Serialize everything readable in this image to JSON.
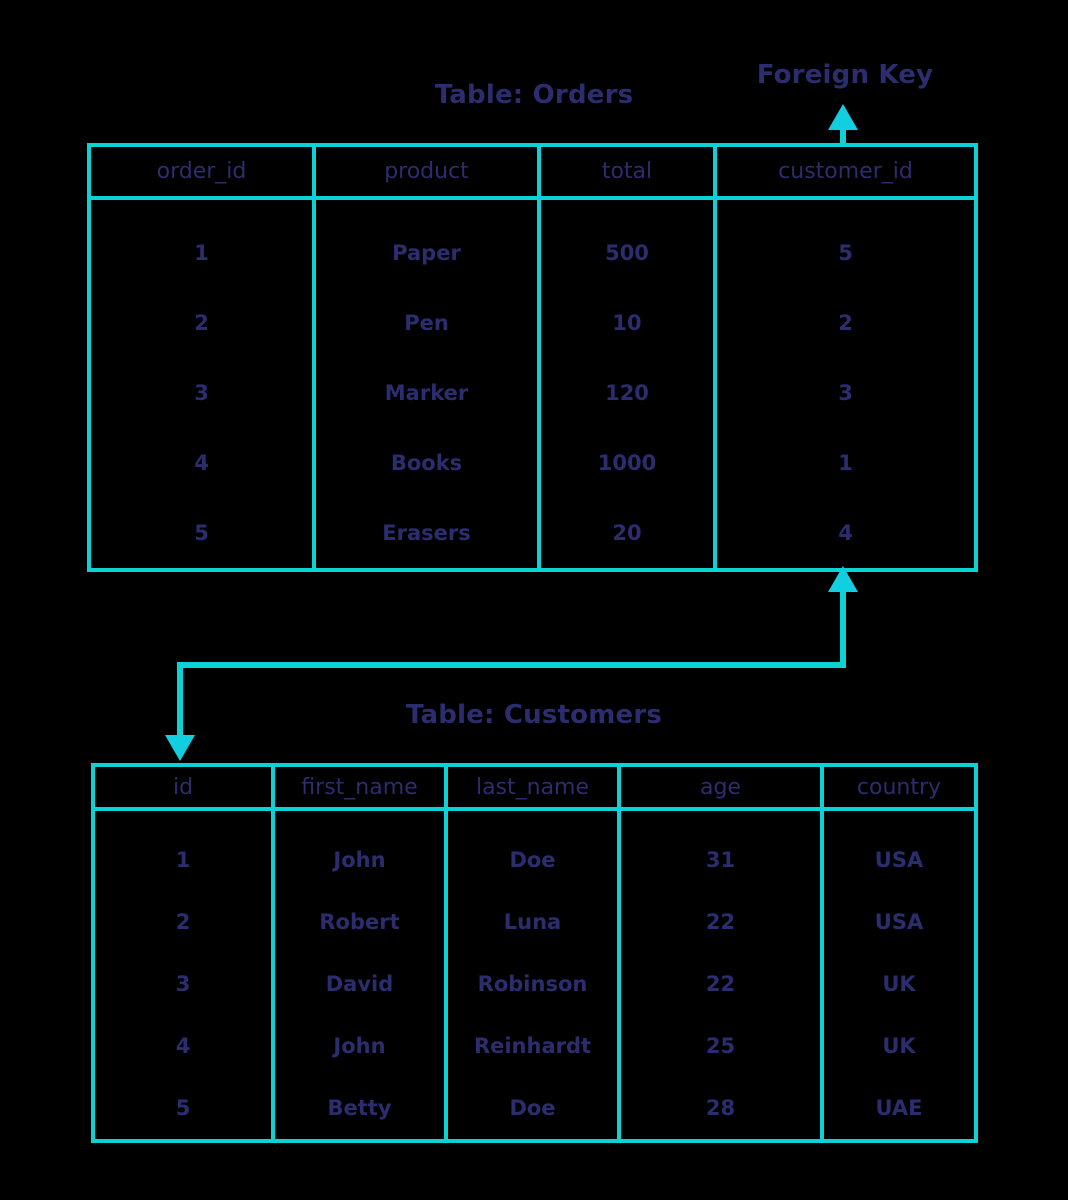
{
  "diagram": {
    "title_orders": "Table: Orders",
    "title_customers": "Table: Customers",
    "foreign_key_label": "Foreign Key",
    "colors": {
      "line": "#0bd3d3",
      "text": "#2b2d6e",
      "background": "#000000"
    }
  },
  "orders": {
    "caption": "Table: Orders",
    "columns": [
      "order_id",
      "product",
      "total",
      "customer_id"
    ],
    "rows": [
      [
        "1",
        "Paper",
        "500",
        "5"
      ],
      [
        "2",
        "Pen",
        "10",
        "2"
      ],
      [
        "3",
        "Marker",
        "120",
        "3"
      ],
      [
        "4",
        "Books",
        "1000",
        "1"
      ],
      [
        "5",
        "Erasers",
        "20",
        "4"
      ]
    ]
  },
  "customers": {
    "caption": "Table: Customers",
    "columns": [
      "id",
      "first_name",
      "last_name",
      "age",
      "country"
    ],
    "rows": [
      [
        "1",
        "John",
        "Doe",
        "31",
        "USA"
      ],
      [
        "2",
        "Robert",
        "Luna",
        "22",
        "USA"
      ],
      [
        "3",
        "David",
        "Robinson",
        "22",
        "UK"
      ],
      [
        "4",
        "John",
        "Reinhardt",
        "25",
        "UK"
      ],
      [
        "5",
        "Betty",
        "Doe",
        "28",
        "UAE"
      ]
    ]
  },
  "annotations": {
    "foreign_key": "Foreign Key"
  }
}
